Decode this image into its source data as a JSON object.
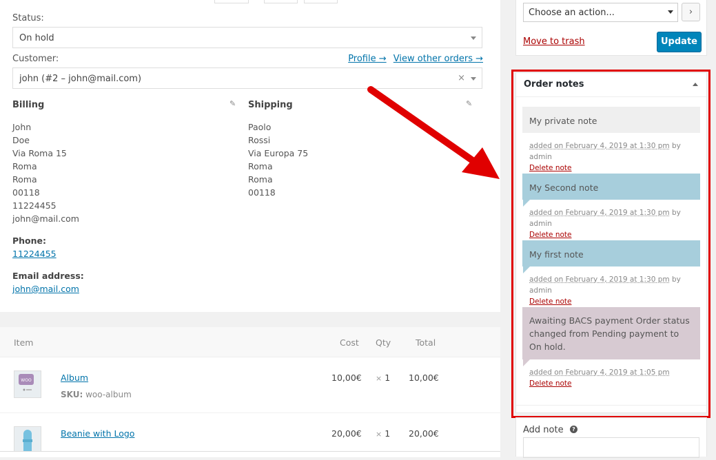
{
  "status": {
    "label": "Status:",
    "value": "On hold"
  },
  "customer": {
    "label": "Customer:",
    "value": "john (#2 – john@mail.com)",
    "clear": "×",
    "profile_link": "Profile →",
    "other_orders_link": "View other orders →"
  },
  "billing": {
    "title": "Billing",
    "lines": [
      "John",
      "Doe",
      "Via Roma 15",
      "Roma",
      "Roma",
      "00118",
      "11224455",
      "john@mail.com"
    ],
    "phone_label": "Phone:",
    "phone": "11224455",
    "email_label": "Email address:",
    "email": "john@mail.com"
  },
  "shipping": {
    "title": "Shipping",
    "lines": [
      "Paolo",
      "Rossi",
      "Via Europa 75",
      "Roma",
      "Roma",
      "00118"
    ]
  },
  "items": {
    "headers": {
      "item": "Item",
      "cost": "Cost",
      "qty": "Qty",
      "total": "Total"
    },
    "rows": [
      {
        "name": "Album",
        "sku_label": "SKU:",
        "sku": "woo-album",
        "cost": "10,00€",
        "times": "×",
        "qty": "1",
        "total": "10,00€"
      },
      {
        "name": "Beanie with Logo",
        "cost": "20,00€",
        "times": "×",
        "qty": "1",
        "total": "20,00€"
      }
    ]
  },
  "actions": {
    "select_value": "Choose an action...",
    "go": "›",
    "trash": "Move to trash",
    "update": "Update"
  },
  "order_notes": {
    "title": "Order notes",
    "notes": [
      {
        "text": "My private note",
        "added": "added on February 4, 2019 at 1:30 pm",
        "by": " by admin",
        "delete": "Delete note"
      },
      {
        "text": "My Second note",
        "added": "added on February 4, 2019 at 1:30 pm",
        "by": " by admin",
        "delete": "Delete note"
      },
      {
        "text": "My first note",
        "added": "added on February 4, 2019 at 1:30 pm",
        "by": " by admin",
        "delete": "Delete note"
      },
      {
        "text": "Awaiting BACS payment Order status changed from Pending payment to On hold.",
        "added": "added on February 4, 2019 at 1:05 pm",
        "delete": "Delete note"
      }
    ]
  },
  "add_note": {
    "label": "Add note",
    "help": "?"
  },
  "colors": {
    "private_note": "#efefef",
    "customer_note": "#a7cedc",
    "system_note": "#d7cad2",
    "highlight_frame": "#e00000",
    "arrow": "#e00000",
    "update_button": "#0085ba"
  }
}
